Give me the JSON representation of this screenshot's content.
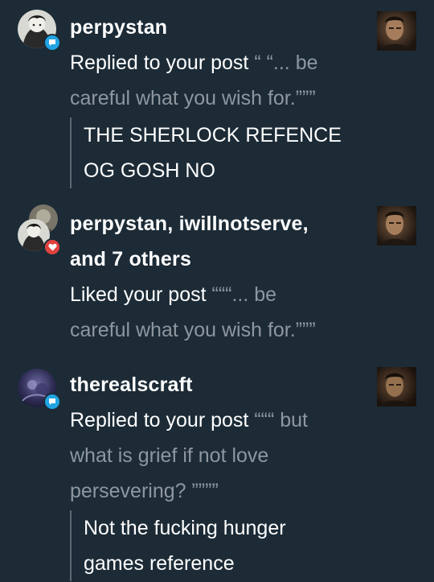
{
  "activities": [
    {
      "username": "perpystan",
      "action": "Replied to your post",
      "post_excerpt_line1": "“ “... be",
      "post_excerpt_line2": "careful what you wish for.”””",
      "reply_line1": "THE SHERLOCK REFENCE",
      "reply_line2": "OG GOSH NO",
      "badge_icon": "speech-bubble-icon",
      "badge_color": "#22a4e3"
    },
    {
      "username_line1": "perpystan, iwillnotserve,",
      "username_line2": "and 7 others",
      "action": "Liked your post",
      "post_excerpt_line1": "“““... be",
      "post_excerpt_line2": "careful what you wish for.”””",
      "badge_icon": "heart-icon",
      "badge_color": "#e0423f"
    },
    {
      "username": "therealscraft",
      "action": "Replied to your post",
      "post_excerpt_line1": "“““ but",
      "post_excerpt_line2": "what is grief if not love",
      "post_excerpt_line3": "persevering? ””””",
      "reply_line1": "Not the fucking hunger",
      "reply_line2": "games reference",
      "badge_icon": "speech-bubble-icon",
      "badge_color": "#22a4e3"
    }
  ],
  "colors": {
    "background": "#1c2b36",
    "muted_text": "#8e979f",
    "quote_border": "#5b6871"
  }
}
